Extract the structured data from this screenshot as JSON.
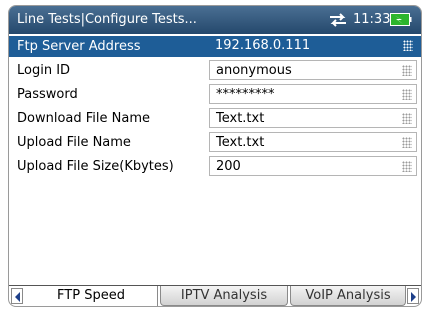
{
  "header": {
    "title": "Line Tests|Configure Tests...",
    "time": "11:33",
    "icons": [
      "network-icon",
      "battery-icon"
    ],
    "title_bar_color": "#2f5479"
  },
  "form": {
    "rows": [
      {
        "label": "Ftp Server Address",
        "value": "192.168.0.111",
        "selected": true
      },
      {
        "label": "Login ID",
        "value": "anonymous"
      },
      {
        "label": "Password",
        "value": "*********"
      },
      {
        "label": "Download File Name",
        "value": "Text.txt"
      },
      {
        "label": "Upload File Name",
        "value": "Text.txt"
      },
      {
        "label": "Upload File Size(Kbytes)",
        "value": "200"
      }
    ],
    "selected_row_color": "#1e5d97"
  },
  "tabs": [
    {
      "label": "FTP Speed",
      "active": true
    },
    {
      "label": "IPTV Analysis"
    },
    {
      "label": "VoIP Analysis"
    }
  ]
}
